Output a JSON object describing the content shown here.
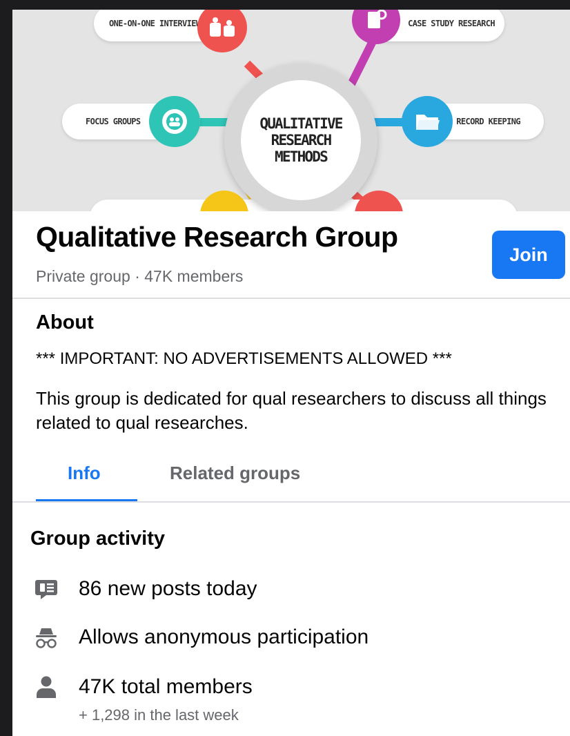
{
  "cover": {
    "hub_lines": [
      "QUALITATIVE",
      "RESEARCH",
      "METHODS"
    ],
    "labels": {
      "interview": "ONE-ON-ONE INTERVIEW",
      "case_study": "CASE STUDY RESEARCH",
      "focus_groups": "FOCUS GROUPS",
      "record_keeping": "RECORD KEEPING"
    },
    "colors": {
      "interview": "#ef5350",
      "case_study": "#c13fb0",
      "focus_groups": "#2ec4b6",
      "record_keeping": "#29a8e0",
      "bottom_left": "#f5c518",
      "bottom_right": "#ef5350"
    }
  },
  "group": {
    "name": "Qualitative Research Group",
    "meta": "Private group · 47K members",
    "join_label": "Join"
  },
  "about": {
    "title": "About",
    "notice": "*** IMPORTANT: NO ADVERTISEMENTS ALLOWED ***",
    "description": "This group is dedicated for qual researchers to discuss all things related to qual researches."
  },
  "tabs": [
    {
      "label": "Info",
      "active": true
    },
    {
      "label": "Related groups",
      "active": false
    }
  ],
  "activity": {
    "title": "Group activity",
    "items": [
      {
        "icon": "posts-icon",
        "text": "86 new posts today"
      },
      {
        "icon": "anonymous-icon",
        "text": "Allows anonymous participation"
      },
      {
        "icon": "member-icon",
        "text": "47K total members",
        "sub": "+ 1,298 in the last week"
      }
    ]
  },
  "colors": {
    "accent": "#1877f2",
    "secondary_text": "#65676b",
    "icon_gray": "#65676b"
  }
}
